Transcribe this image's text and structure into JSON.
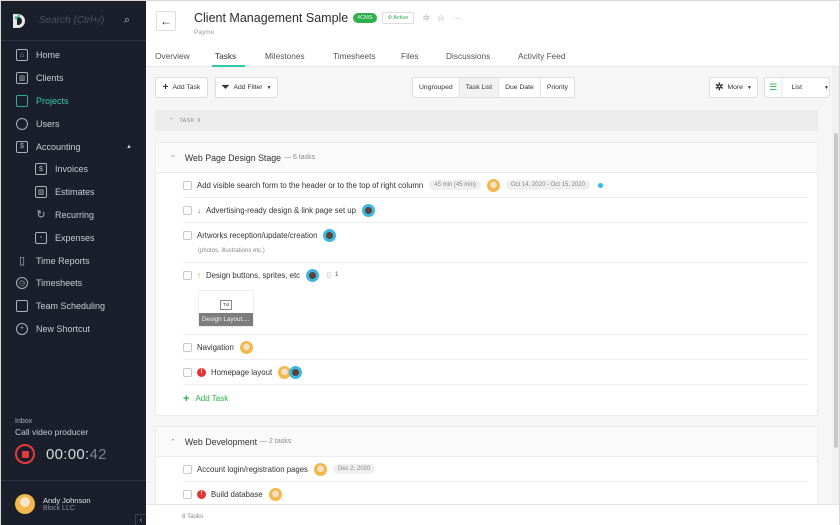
{
  "sidebar": {
    "search_placeholder": "Search (Ctrl+/)",
    "items": [
      {
        "label": "Home",
        "icon": "home-icon"
      },
      {
        "label": "Clients",
        "icon": "clients-icon"
      },
      {
        "label": "Projects",
        "icon": "folder-icon",
        "active": true
      },
      {
        "label": "Users",
        "icon": "user-icon"
      },
      {
        "label": "Accounting",
        "icon": "accounting-icon",
        "expanded": true
      },
      {
        "label": "Invoices",
        "icon": "invoice-icon"
      },
      {
        "label": "Estimates",
        "icon": "estimate-icon"
      },
      {
        "label": "Recurring",
        "icon": "recurring-icon"
      },
      {
        "label": "Expenses",
        "icon": "wallet-icon"
      },
      {
        "label": "Time Reports",
        "icon": "bar-chart-icon"
      },
      {
        "label": "Timesheets",
        "icon": "clock-icon"
      },
      {
        "label": "Team Scheduling",
        "icon": "calendar-icon"
      },
      {
        "label": "New Shortcut",
        "icon": "plus-circle-icon"
      }
    ],
    "inbox": {
      "label": "Inbox",
      "task": "Call video producer",
      "time_main": "00:00:",
      "time_sec": "42"
    },
    "user": {
      "name": "Andy Johnson",
      "company": "Block LLC"
    }
  },
  "header": {
    "title": "Client Management Sample",
    "tag": "#CMS",
    "status": "Active",
    "client": "Paymo",
    "tabs": [
      "Overview",
      "Tasks",
      "Milestones",
      "Timesheets",
      "Files",
      "Discussions",
      "Activity Feed"
    ],
    "active_tab": "Tasks"
  },
  "toolbar": {
    "add_task": "Add Task",
    "add_filter": "Add Filter",
    "grouping": [
      "Ungrouped",
      "Task List",
      "Due Date",
      "Priority"
    ],
    "selected_grouping": "Task List",
    "more": "More",
    "view": "List"
  },
  "table": {
    "header": "TASK"
  },
  "groups": [
    {
      "name": "Web Page Design Stage",
      "count": "— 6 tasks",
      "tasks": [
        {
          "name": "Add visible search form to the header or to the top of right column",
          "time": "45 min (45 min)",
          "dates": "Oct 14, 2020 - Oct 15, 2020"
        },
        {
          "name": "Advertising-ready design & link page set up",
          "priority": "low"
        },
        {
          "name": "Artworks reception/update/creation",
          "note": "(photos, illustrations etc.)"
        },
        {
          "name": "Design buttons, sprites, etc",
          "priority": "high",
          "files": "1",
          "attachment": {
            "type": "Txt",
            "name": "Design Layout...."
          }
        },
        {
          "name": "Navigation"
        },
        {
          "name": "Homepage layout",
          "priority": "critical"
        }
      ],
      "add_task": "Add Task"
    },
    {
      "name": "Web Development",
      "count": "— 2 tasks",
      "tasks": [
        {
          "name": "Account login/registration pages",
          "dates": "Dec 2, 2020"
        },
        {
          "name": "Build database",
          "priority": "critical"
        }
      ]
    }
  ],
  "footer": {
    "total": "8 Tasks"
  }
}
